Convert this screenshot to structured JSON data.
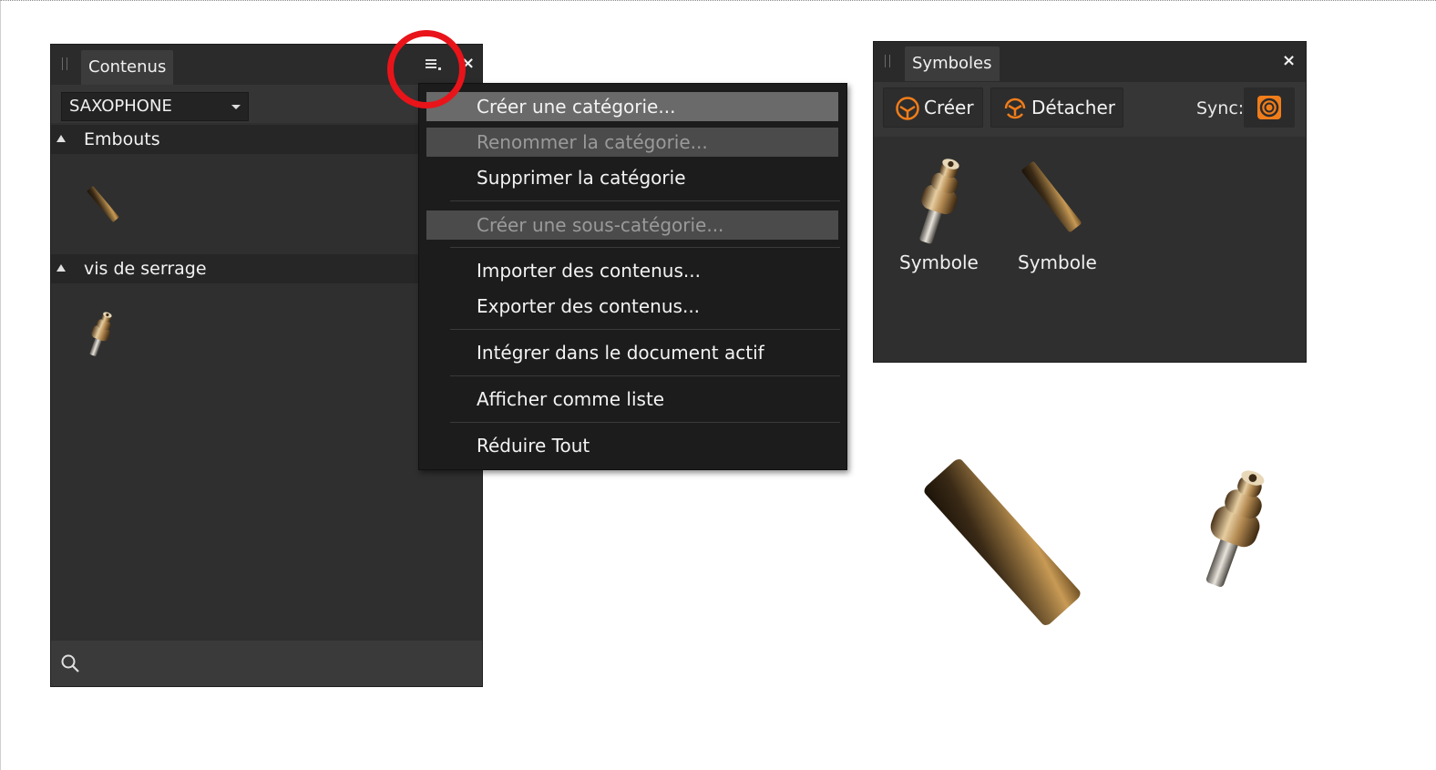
{
  "contents_panel": {
    "tab_title": "Contenus",
    "category_select": "SAXOPHONE",
    "categories": [
      {
        "label": "Embouts"
      },
      {
        "label": "vis de serrage"
      }
    ],
    "icons": {
      "menu": "hamburger-menu-icon",
      "close": "close-icon",
      "search": "search-icon"
    },
    "close_glyph": "×"
  },
  "context_menu": {
    "items": [
      {
        "label": "Créer une catégorie...",
        "state": "hover"
      },
      {
        "label": "Renommer la catégorie...",
        "state": "disabled"
      },
      {
        "label": "Supprimer la catégorie",
        "state": "normal"
      },
      {
        "label": "Créer une sous-catégorie...",
        "state": "disabled"
      },
      {
        "label": "Importer des contenus...",
        "state": "normal"
      },
      {
        "label": "Exporter des contenus...",
        "state": "normal"
      },
      {
        "label": "Intégrer dans le document actif",
        "state": "normal"
      },
      {
        "label": "Afficher comme liste",
        "state": "normal"
      },
      {
        "label": "Réduire Tout",
        "state": "normal"
      }
    ]
  },
  "symbols_panel": {
    "tab_title": "Symboles",
    "create_button": "Créer",
    "detach_button": "Détacher",
    "sync_label": "Sync:",
    "items": [
      {
        "label": "Symbole"
      },
      {
        "label": "Symbole"
      }
    ],
    "close_glyph": "×"
  },
  "colors": {
    "accent_orange": "#f07d1a",
    "highlight_ring": "#e8141a",
    "panel_bg": "#2f2f2f",
    "menu_bg": "#1c1c1c"
  }
}
